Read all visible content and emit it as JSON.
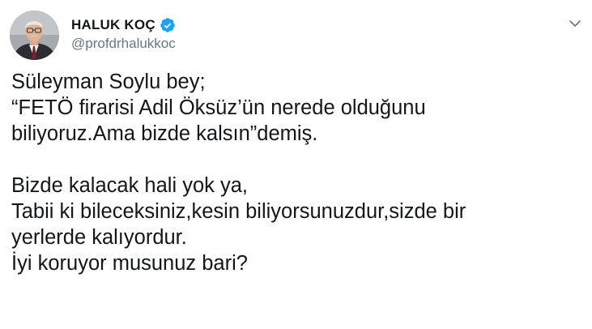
{
  "author": {
    "display_name": "HALUK KOÇ",
    "handle": "@profdrhalukkoc",
    "verified": true,
    "avatar_icon": "person-portrait-avatar",
    "verified_icon": "verified-badge-icon"
  },
  "menu": {
    "caret_icon": "chevron-down-icon"
  },
  "tweet": {
    "lines": [
      "Süleyman Soylu bey;",
      "“FETÖ firarisi Adil Öksüz’ün nerede olduğunu",
      "biliyoruz.Ama bizde kalsın”demiş.",
      "",
      "Bizde kalacak hali yok ya,",
      "Tabii ki bileceksiniz,kesin biliyorsunuzdur,sizde bir",
      "yerlerde kalıyordur.",
      "İyi koruyor musunuz bari?"
    ]
  },
  "colors": {
    "text": "#14171a",
    "secondary_text": "#657786",
    "verified_blue": "#1da1f2",
    "background": "#ffffff"
  }
}
